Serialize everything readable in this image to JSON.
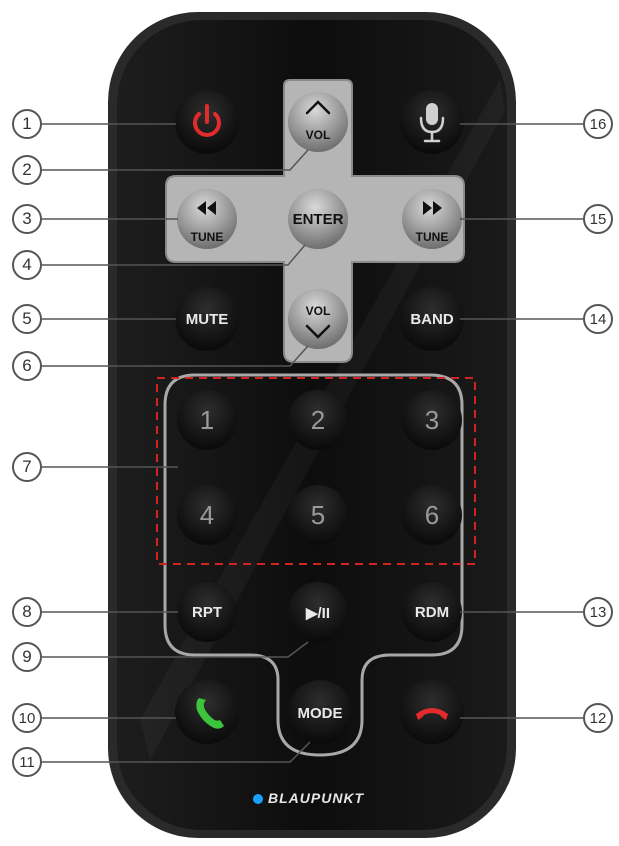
{
  "colors": {
    "body": "#0c0c0c",
    "nav_pad": "#b8b8b8",
    "numpad_outline": "#a8a8a8",
    "dashed": "#d32222",
    "power": "#e22b2b",
    "call": "#3cc43c",
    "hangup": "#e22b2b",
    "brand_dot": "#1aa0ff"
  },
  "buttons": {
    "vol_up": "VOL",
    "vol_down": "VOL",
    "tune_prev": "TUNE",
    "tune_next": "TUNE",
    "enter": "ENTER",
    "mute": "MUTE",
    "band": "BAND",
    "n1": "1",
    "n2": "2",
    "n3": "3",
    "n4": "4",
    "n5": "5",
    "n6": "6",
    "rpt": "RPT",
    "play_pause": "▶/II",
    "rdm": "RDM",
    "mode": "MODE"
  },
  "icons": {
    "power": "power-icon",
    "microphone": "microphone-icon",
    "rewind": "rewind-icon",
    "fast_forward": "fast-forward-icon",
    "call": "phone-answer-icon",
    "hangup": "phone-hangup-icon"
  },
  "callouts": [
    "1",
    "2",
    "3",
    "4",
    "5",
    "6",
    "7",
    "8",
    "9",
    "10",
    "11",
    "12",
    "13",
    "14",
    "15",
    "16"
  ],
  "brand": "BLAUPUNKT"
}
